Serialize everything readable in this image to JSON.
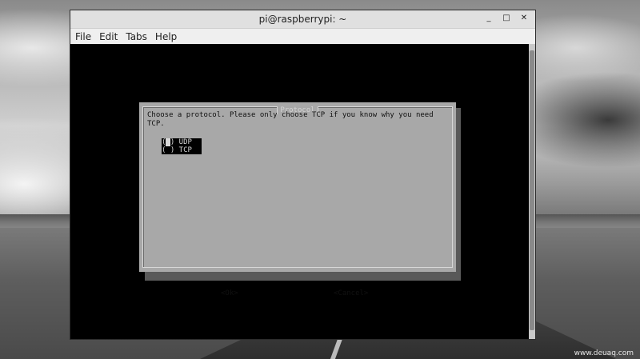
{
  "window": {
    "title": "pi@raspberrypi: ~",
    "controls": {
      "minimize": "_",
      "maximize": "□",
      "close": "✕"
    }
  },
  "menubar": [
    "File",
    "Edit",
    "Tabs",
    "Help"
  ],
  "dialog": {
    "title": "Protocol",
    "message": "Choose a protocol. Please only choose TCP if you know why you need\nTCP.",
    "options": [
      {
        "mark": "(",
        "cursor": " ",
        "rest": ") UDP"
      },
      {
        "mark": "(",
        "cursor": " ",
        "rest": ") TCP"
      }
    ],
    "ok_label": "<Ok>",
    "cancel_label": "<Cancel>"
  },
  "watermark": "www.deuaq.com"
}
